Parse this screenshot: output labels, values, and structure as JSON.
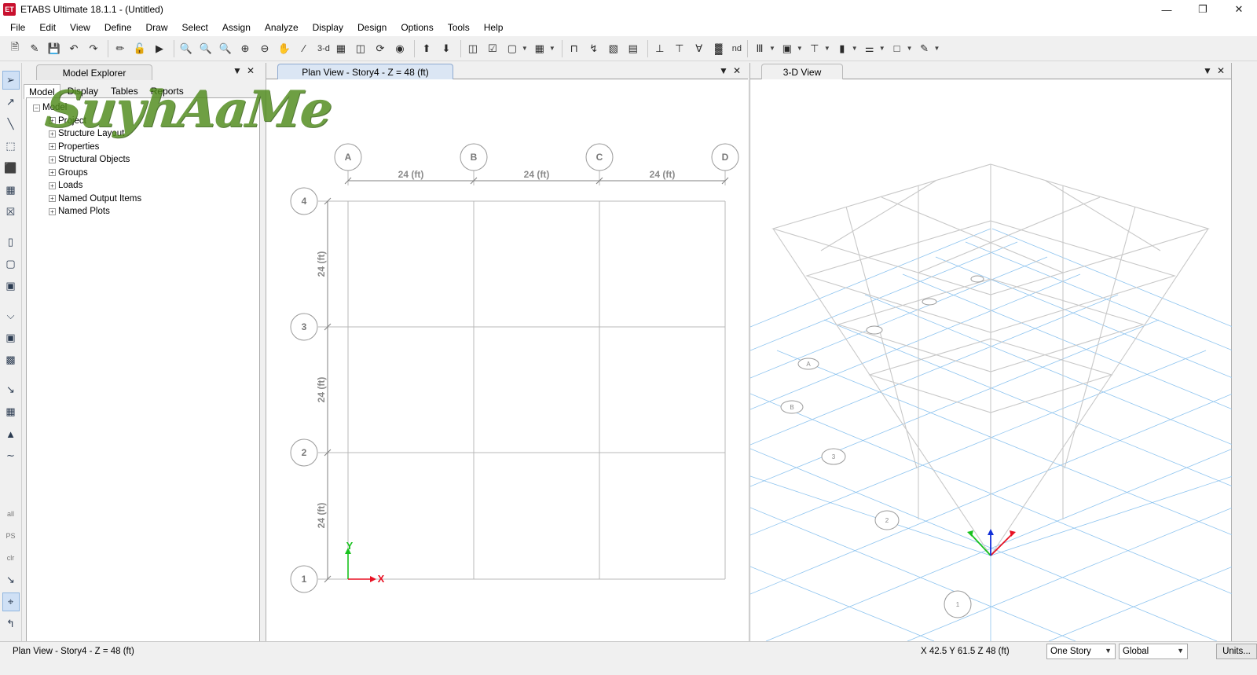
{
  "window": {
    "title": "ETABS Ultimate 18.1.1 - (Untitled)",
    "icon_label": "ET"
  },
  "menu": [
    "File",
    "Edit",
    "View",
    "Define",
    "Draw",
    "Select",
    "Assign",
    "Analyze",
    "Display",
    "Design",
    "Options",
    "Tools",
    "Help"
  ],
  "toolbar": {
    "view_3d_label": "3-d",
    "nd_label": "nd"
  },
  "left_toolbar": {
    "all_label": "all",
    "ps_label": "PS",
    "clr_label": "clr"
  },
  "explorer": {
    "title": "Model Explorer",
    "tabs": [
      "Model",
      "Display",
      "Tables",
      "Reports"
    ],
    "active_tab": "Model",
    "root": "Model",
    "items": [
      "Project",
      "Structure Layout",
      "Properties",
      "Structural Objects",
      "Groups",
      "Loads",
      "Named Output Items",
      "Named Plots"
    ]
  },
  "watermark": {
    "text": "SuyhAaMe"
  },
  "plan_view": {
    "tab_title": "Plan View - Story4 - Z = 48 (ft)",
    "grid_x_labels": [
      "A",
      "B",
      "C",
      "D"
    ],
    "grid_y_labels": [
      "4",
      "3",
      "2",
      "1"
    ],
    "dim_x": [
      "24 (ft)",
      "24 (ft)",
      "24 (ft)"
    ],
    "dim_y": [
      "24 (ft)",
      "24 (ft)",
      "24 (ft)"
    ],
    "axis_x": "X",
    "axis_y": "Y"
  },
  "view_3d": {
    "tab_title": "3-D View",
    "bubble_labels": [
      "A",
      "B",
      "3",
      "2",
      "1"
    ]
  },
  "status": {
    "left_text": "Plan View - Story4 - Z = 48 (ft)",
    "coords": "X 42.5  Y 61.5  Z 48 (ft)",
    "story_option": "One Story",
    "coord_option": "Global",
    "units_button": "Units..."
  },
  "colors": {
    "accent_blue": "#4a90d9",
    "grid_line": "#b8b8b8",
    "x_axis": "#e81123",
    "y_axis": "#19c21e",
    "z_axis": "#1230d8",
    "ground_grid": "#8ec4ef"
  }
}
